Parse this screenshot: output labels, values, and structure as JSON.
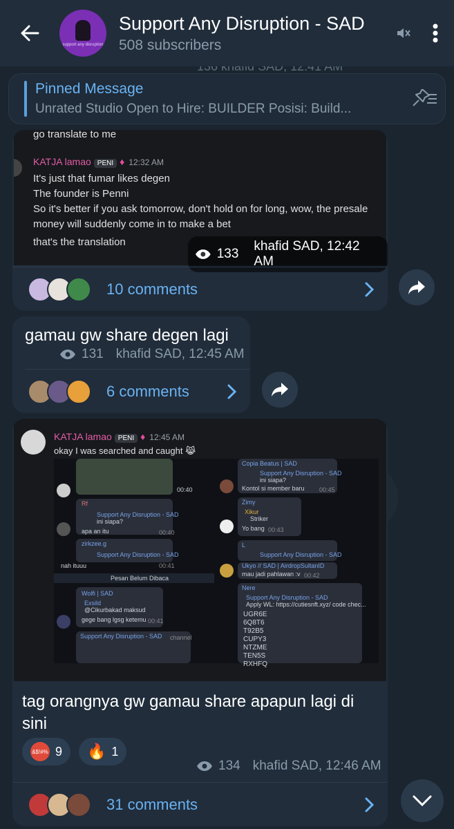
{
  "header": {
    "title": "Support Any Disruption - SAD",
    "subscribers": "508 subscribers",
    "avatar_caption": "support any disruption"
  },
  "ghost_meta": "136   khafid SAD, 12:41 AM",
  "pinned": {
    "title": "Pinned Message",
    "text": "Unrated Studio Open to Hire: BUILDER  Posisi: Build..."
  },
  "post1": {
    "top_cut_text": "go translate to me",
    "author": "KATJA lamao",
    "badge": "PENI",
    "time": "12:32 AM",
    "lines": [
      "It's just that fumar likes degen",
      "The founder is Penni",
      "So it's better if you ask tomorrow, don't hold on for long, wow, the presale",
      "money will suddenly come in to make a bet",
      "that's the translation"
    ],
    "views": "133",
    "signature": "khafid SAD, 12:42 AM",
    "comments": "10 comments"
  },
  "post2": {
    "text": "gamau gw share degen lagi",
    "views": "131",
    "signature": "khafid SAD, 12:45 AM",
    "comments": "6 comments"
  },
  "post3": {
    "author": "KATJA lamao",
    "badge": "PENI",
    "time": "12:45 AM",
    "line": "okay I was searched and caught",
    "mini": {
      "video_time": "00:40",
      "rf_name": "Rf",
      "quote1_title": "Support Any Disruption - SAD",
      "quote1_text": "ini siapa?",
      "msg_apa": "apa an itu",
      "msg_apa_time": "00:40",
      "zirk_name": "zirkzee.g",
      "quote2_title": "Support Any Disruption - SAD",
      "msg_nah": "nah ituuu",
      "msg_nah_time": "00:41",
      "unread": "Pesan Belum Dibaca",
      "wolfi_name": "Wolfi | SAD",
      "exs_name": "Exsild",
      "exs_text": "@Cikurbakad maksud",
      "gege_text": "gege bang lgsg ketemu",
      "gege_time": "00:41",
      "channel_title": "Support Any Disruption - SAD",
      "channel_tag": "channel",
      "copia_name": "Copia Beatus | SAD",
      "quote3_title": "Support Any Disruption - SAD",
      "quote3_text": "ini siapa?",
      "kontol_text": "Kontol si member baru",
      "kontol_time": "00:45",
      "zimy_name": "Zimy",
      "xikur_name": "Xikur",
      "xikur_text": "Striker",
      "yo_text": "Yo bang",
      "yo_time": "00:43",
      "l_name": "L",
      "quote4_title": "Support Any Disruption - SAD",
      "quote4_text": "ini siapa?",
      "ukyo_name": "Ukyo // SAD | AirdropSultanID",
      "pahlawan_text": "mau jadi pahlawan :v",
      "pahlawan_time": "00:42",
      "nere_name": "Nere",
      "quote5_title": "Support Any Disruption - SAD",
      "quote5_text": "Apply WL: https://cutiesnft.xyz/  code chec...",
      "codes": [
        "UGR6E",
        "6Q8T6",
        "T92B5",
        "CUPY3",
        "NTZME",
        "TEN5S",
        "RXHFQ"
      ]
    },
    "caption_line1": "tag orangnya gw gamau share apapun lagi di",
    "caption_line2": "sini",
    "reactions": [
      {
        "label": "&$!#%",
        "count": "9"
      },
      {
        "label": "fire",
        "count": "1"
      }
    ],
    "views": "134",
    "signature": "khafid SAD, 12:46 AM",
    "comments": "31 comments"
  },
  "colors": {
    "accent_blue": "#6ab3f3",
    "bubble": "#212d3b",
    "author_pink": "#e45ca5"
  }
}
